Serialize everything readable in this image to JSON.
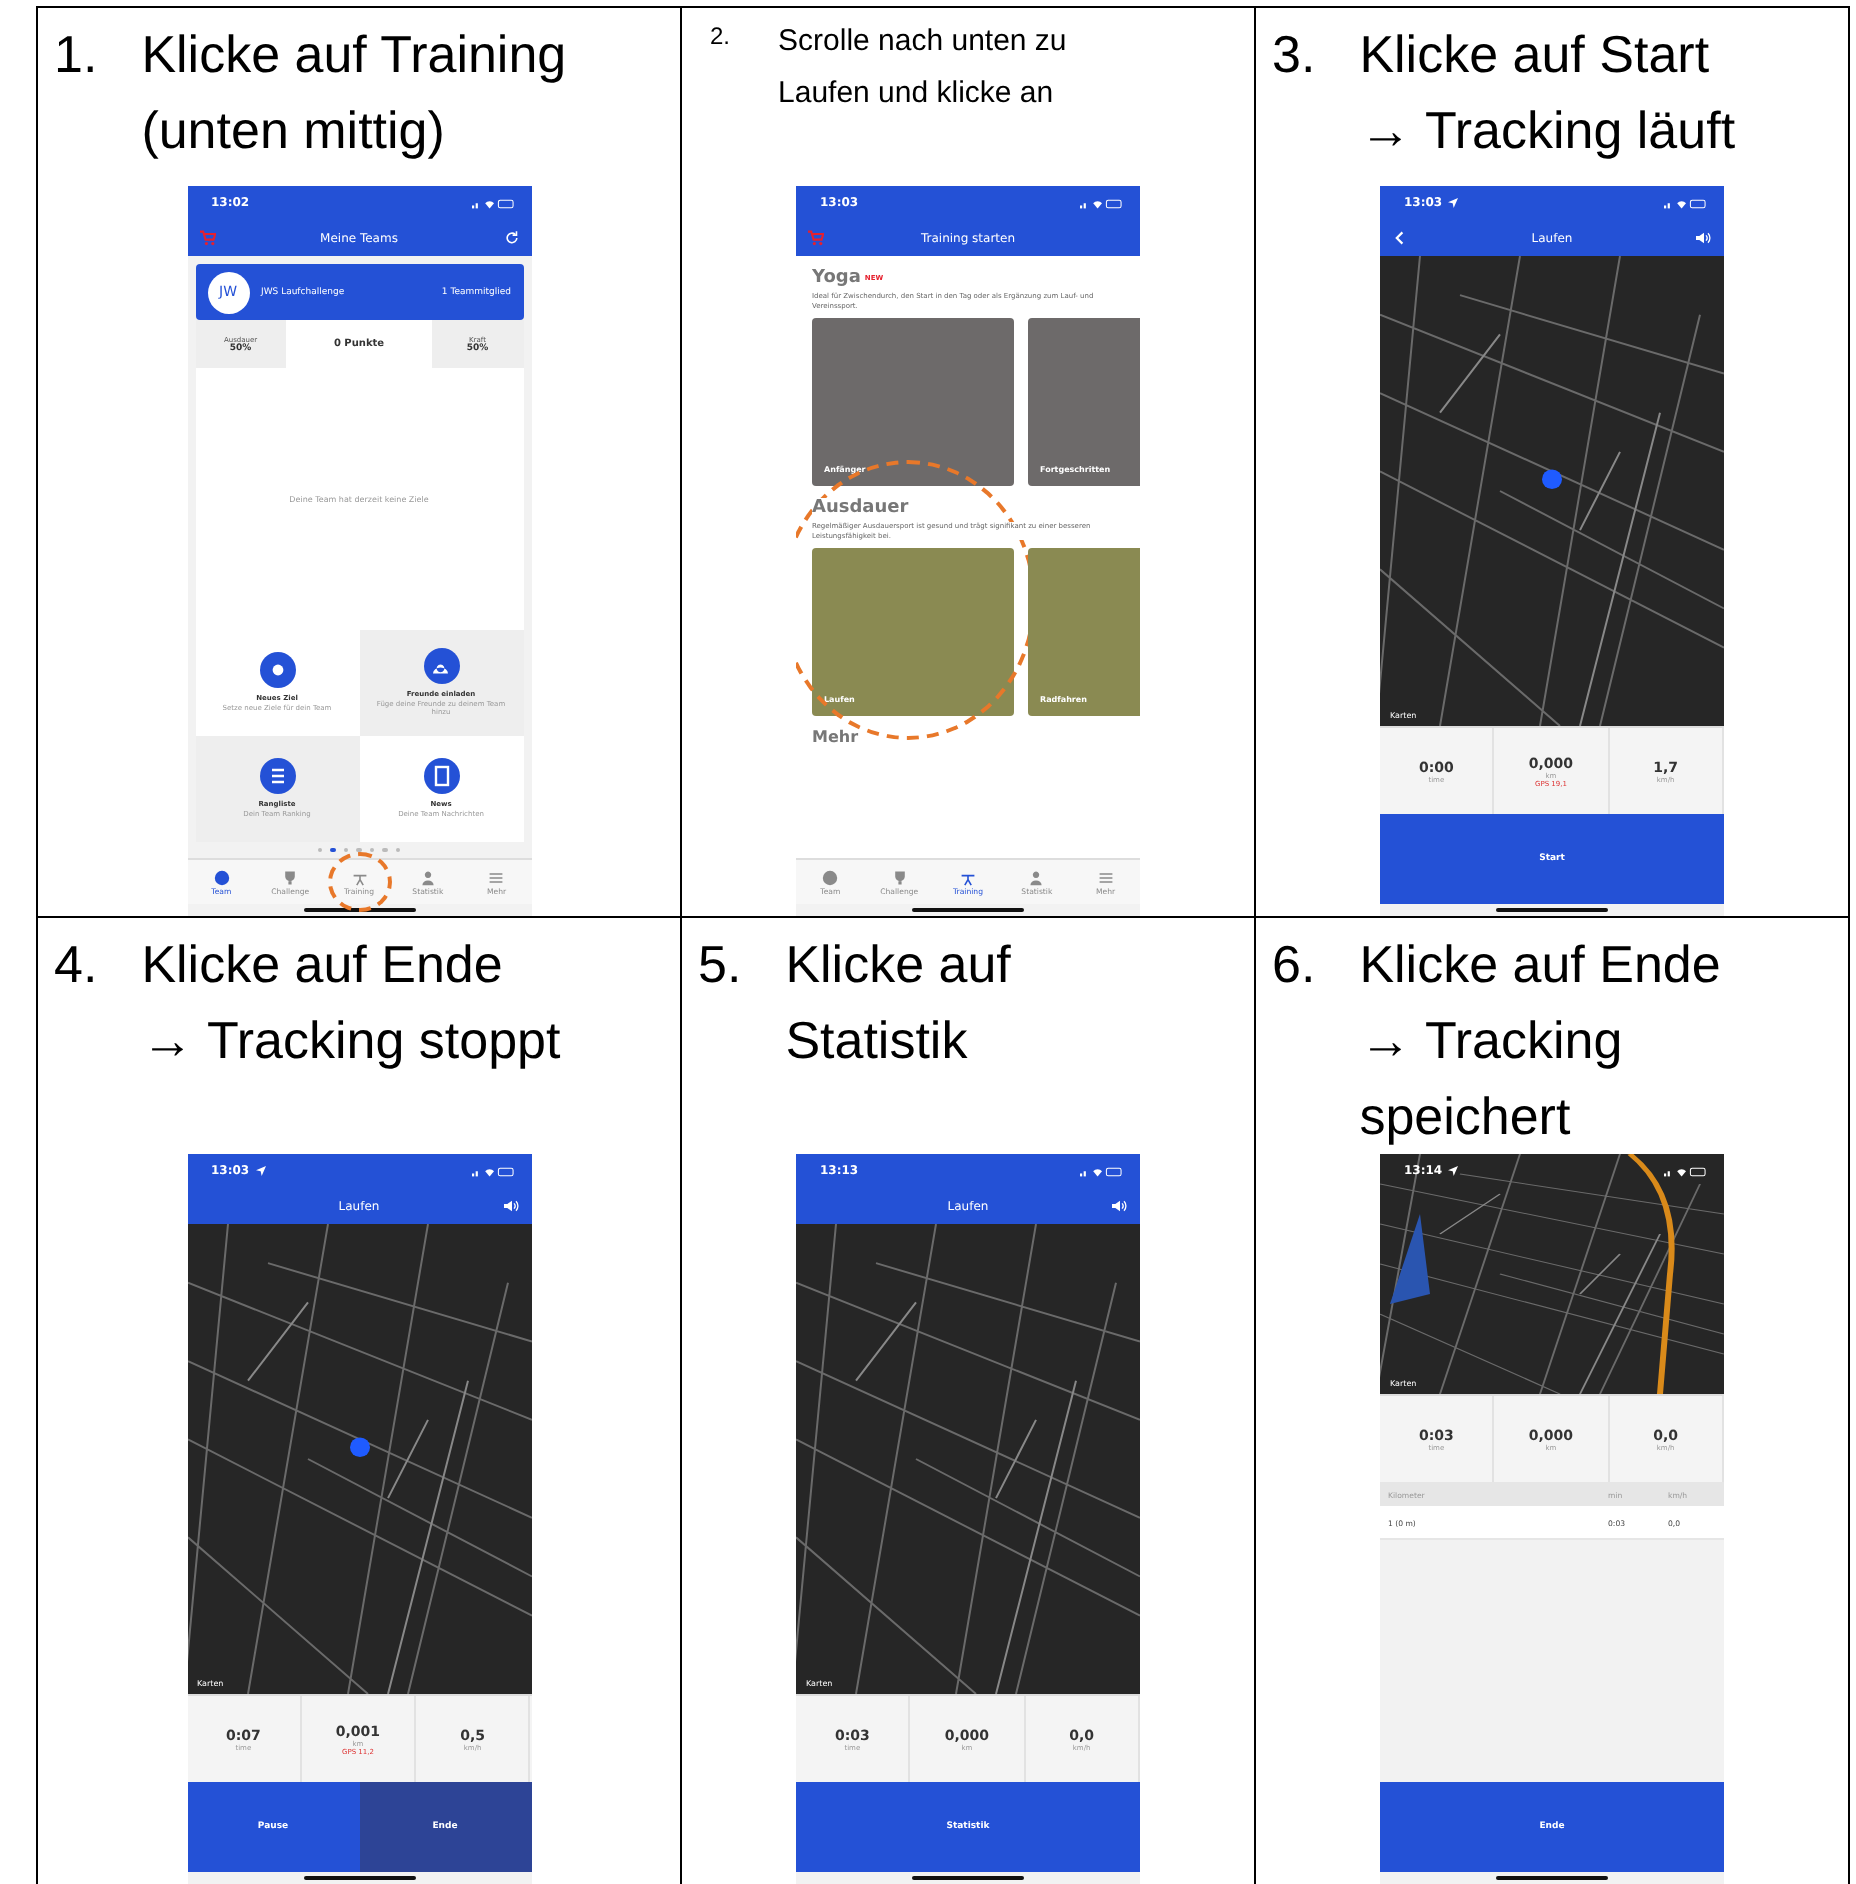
{
  "steps": [
    {
      "number": "1.",
      "lines": [
        "Klicke auf Training",
        "(unten mittig)"
      ],
      "screen": {
        "kind": "team",
        "time": "13:02",
        "title": "Meine Teams",
        "cart": true,
        "refresh": true,
        "team": {
          "initials": "JW",
          "name": "JWS Laufchallenge",
          "members": "1 Teammitglied"
        },
        "team_stats": [
          {
            "label": "Ausdauer",
            "value": "50",
            "unit": "%"
          },
          {
            "label": "Punkte",
            "value": "0"
          },
          {
            "label": "Kraft",
            "value": "50",
            "unit": "%"
          }
        ],
        "empty_text": "Deine Team hat derzeit keine Ziele",
        "tiles": [
          {
            "title": "Neues Ziel",
            "subtitle": "Setze neue Ziele für dein Team"
          },
          {
            "title": "Freunde einladen",
            "subtitle": "Füge deine Freunde zu deinem Team hinzu"
          },
          {
            "title": "Rangliste",
            "subtitle": "Dein Team Ranking"
          },
          {
            "title": "News",
            "subtitle": "Deine Team Nachrichten"
          }
        ],
        "page_dots": [
          {
            "selected": false
          },
          {
            "selected": true
          },
          {
            "selected": false
          },
          {
            "selected": false
          },
          {
            "selected": false
          },
          {
            "selected": false
          },
          {
            "selected": false
          }
        ],
        "tabs": [
          {
            "label": "Team",
            "selected": true
          },
          {
            "label": "Challenge",
            "selected": false
          },
          {
            "label": "Training",
            "selected": false,
            "circled": true
          },
          {
            "label": "Statistik",
            "selected": false
          },
          {
            "label": "Mehr",
            "selected": false
          }
        ]
      }
    },
    {
      "number": "2.",
      "lines": [
        "Scrolle nach unten zu",
        "Laufen und klicke an"
      ],
      "screen": {
        "kind": "training",
        "time": "13:03",
        "title": "Training starten",
        "cart": true,
        "sections": [
          {
            "title": "Yoga",
            "badge": "NEW",
            "text": "Ideal für Zwischendurch, den Start in den Tag oder als Ergänzung zum Lauf- und Vereinssport.",
            "cards": [
              {
                "label": "Anfänger"
              },
              {
                "label": "Fortgeschritten"
              }
            ]
          },
          {
            "title": "Ausdauer",
            "text": "Regelmäßiger Ausdauersport ist gesund und trägt signifikant zu einer besseren Leistungsfähigkeit bei.",
            "cards": [
              {
                "label": "Laufen",
                "circled": true
              },
              {
                "label": "Radfahren"
              }
            ]
          }
        ],
        "next_section": "Mehr",
        "tabs": [
          {
            "label": "Team",
            "selected": false
          },
          {
            "label": "Challenge",
            "selected": false
          },
          {
            "label": "Training",
            "selected": true
          },
          {
            "label": "Statistik",
            "selected": false
          },
          {
            "label": "Mehr",
            "selected": false
          }
        ]
      }
    },
    {
      "number": "3.",
      "lines": [
        "Klicke auf Start",
        "→ Tracking läuft"
      ],
      "screen": {
        "kind": "tracking",
        "time": "13:03",
        "location_arrow": true,
        "title": "Laufen",
        "back": true,
        "sound": true,
        "map": {
          "position": true,
          "credit": "Karten"
        },
        "stats": [
          {
            "value": "0:00",
            "unit": "time"
          },
          {
            "value": "0,000",
            "unit": "km",
            "note": "GPS 19,1"
          },
          {
            "value": "1,7",
            "unit": "km/h"
          }
        ],
        "buttons": [
          {
            "label": "Start",
            "kind": "primary"
          }
        ]
      }
    },
    {
      "number": "4.",
      "lines": [
        "Klicke auf Ende",
        "→ Tracking stoppt"
      ],
      "screen": {
        "kind": "tracking",
        "time": "13:03",
        "location_arrow": true,
        "title": "Laufen",
        "sound": true,
        "map": {
          "position": true,
          "credit": "Karten"
        },
        "stats": [
          {
            "value": "0:07",
            "unit": "time"
          },
          {
            "value": "0,001",
            "unit": "km",
            "note": "GPS 11,2"
          },
          {
            "value": "0,5",
            "unit": "km/h"
          }
        ],
        "buttons": [
          {
            "label": "Pause",
            "kind": "primary"
          },
          {
            "label": "Ende",
            "kind": "dark"
          }
        ]
      }
    },
    {
      "number": "5.",
      "lines": [
        "Klicke auf",
        "Statistik"
      ],
      "screen": {
        "kind": "tracking",
        "time": "13:13",
        "title": "Laufen",
        "sound": true,
        "map": {
          "credit": "Karten"
        },
        "stats": [
          {
            "value": "0:03",
            "unit": "time"
          },
          {
            "value": "0,000",
            "unit": "km"
          },
          {
            "value": "0,0",
            "unit": "km/h"
          }
        ],
        "buttons": [
          {
            "label": "Statistik",
            "kind": "primary"
          }
        ]
      }
    },
    {
      "number": "6.",
      "lines": [
        "Klicke auf Ende",
        "→ Tracking",
        "speichert"
      ],
      "screen": {
        "kind": "summary",
        "time": "13:14",
        "location_arrow": true,
        "map": {
          "route": true,
          "credit": "Karten"
        },
        "stats": [
          {
            "value": "0:03",
            "unit": "time"
          },
          {
            "value": "0,000",
            "unit": "km"
          },
          {
            "value": "0,0",
            "unit": "km/h"
          }
        ],
        "splits": {
          "columns": [
            "Kilometer",
            "min",
            "km/h"
          ],
          "rows": [
            [
              "1 (0 m)",
              "0:03",
              "0,0"
            ]
          ]
        },
        "buttons": [
          {
            "label": "Ende",
            "kind": "primary"
          }
        ]
      }
    }
  ]
}
